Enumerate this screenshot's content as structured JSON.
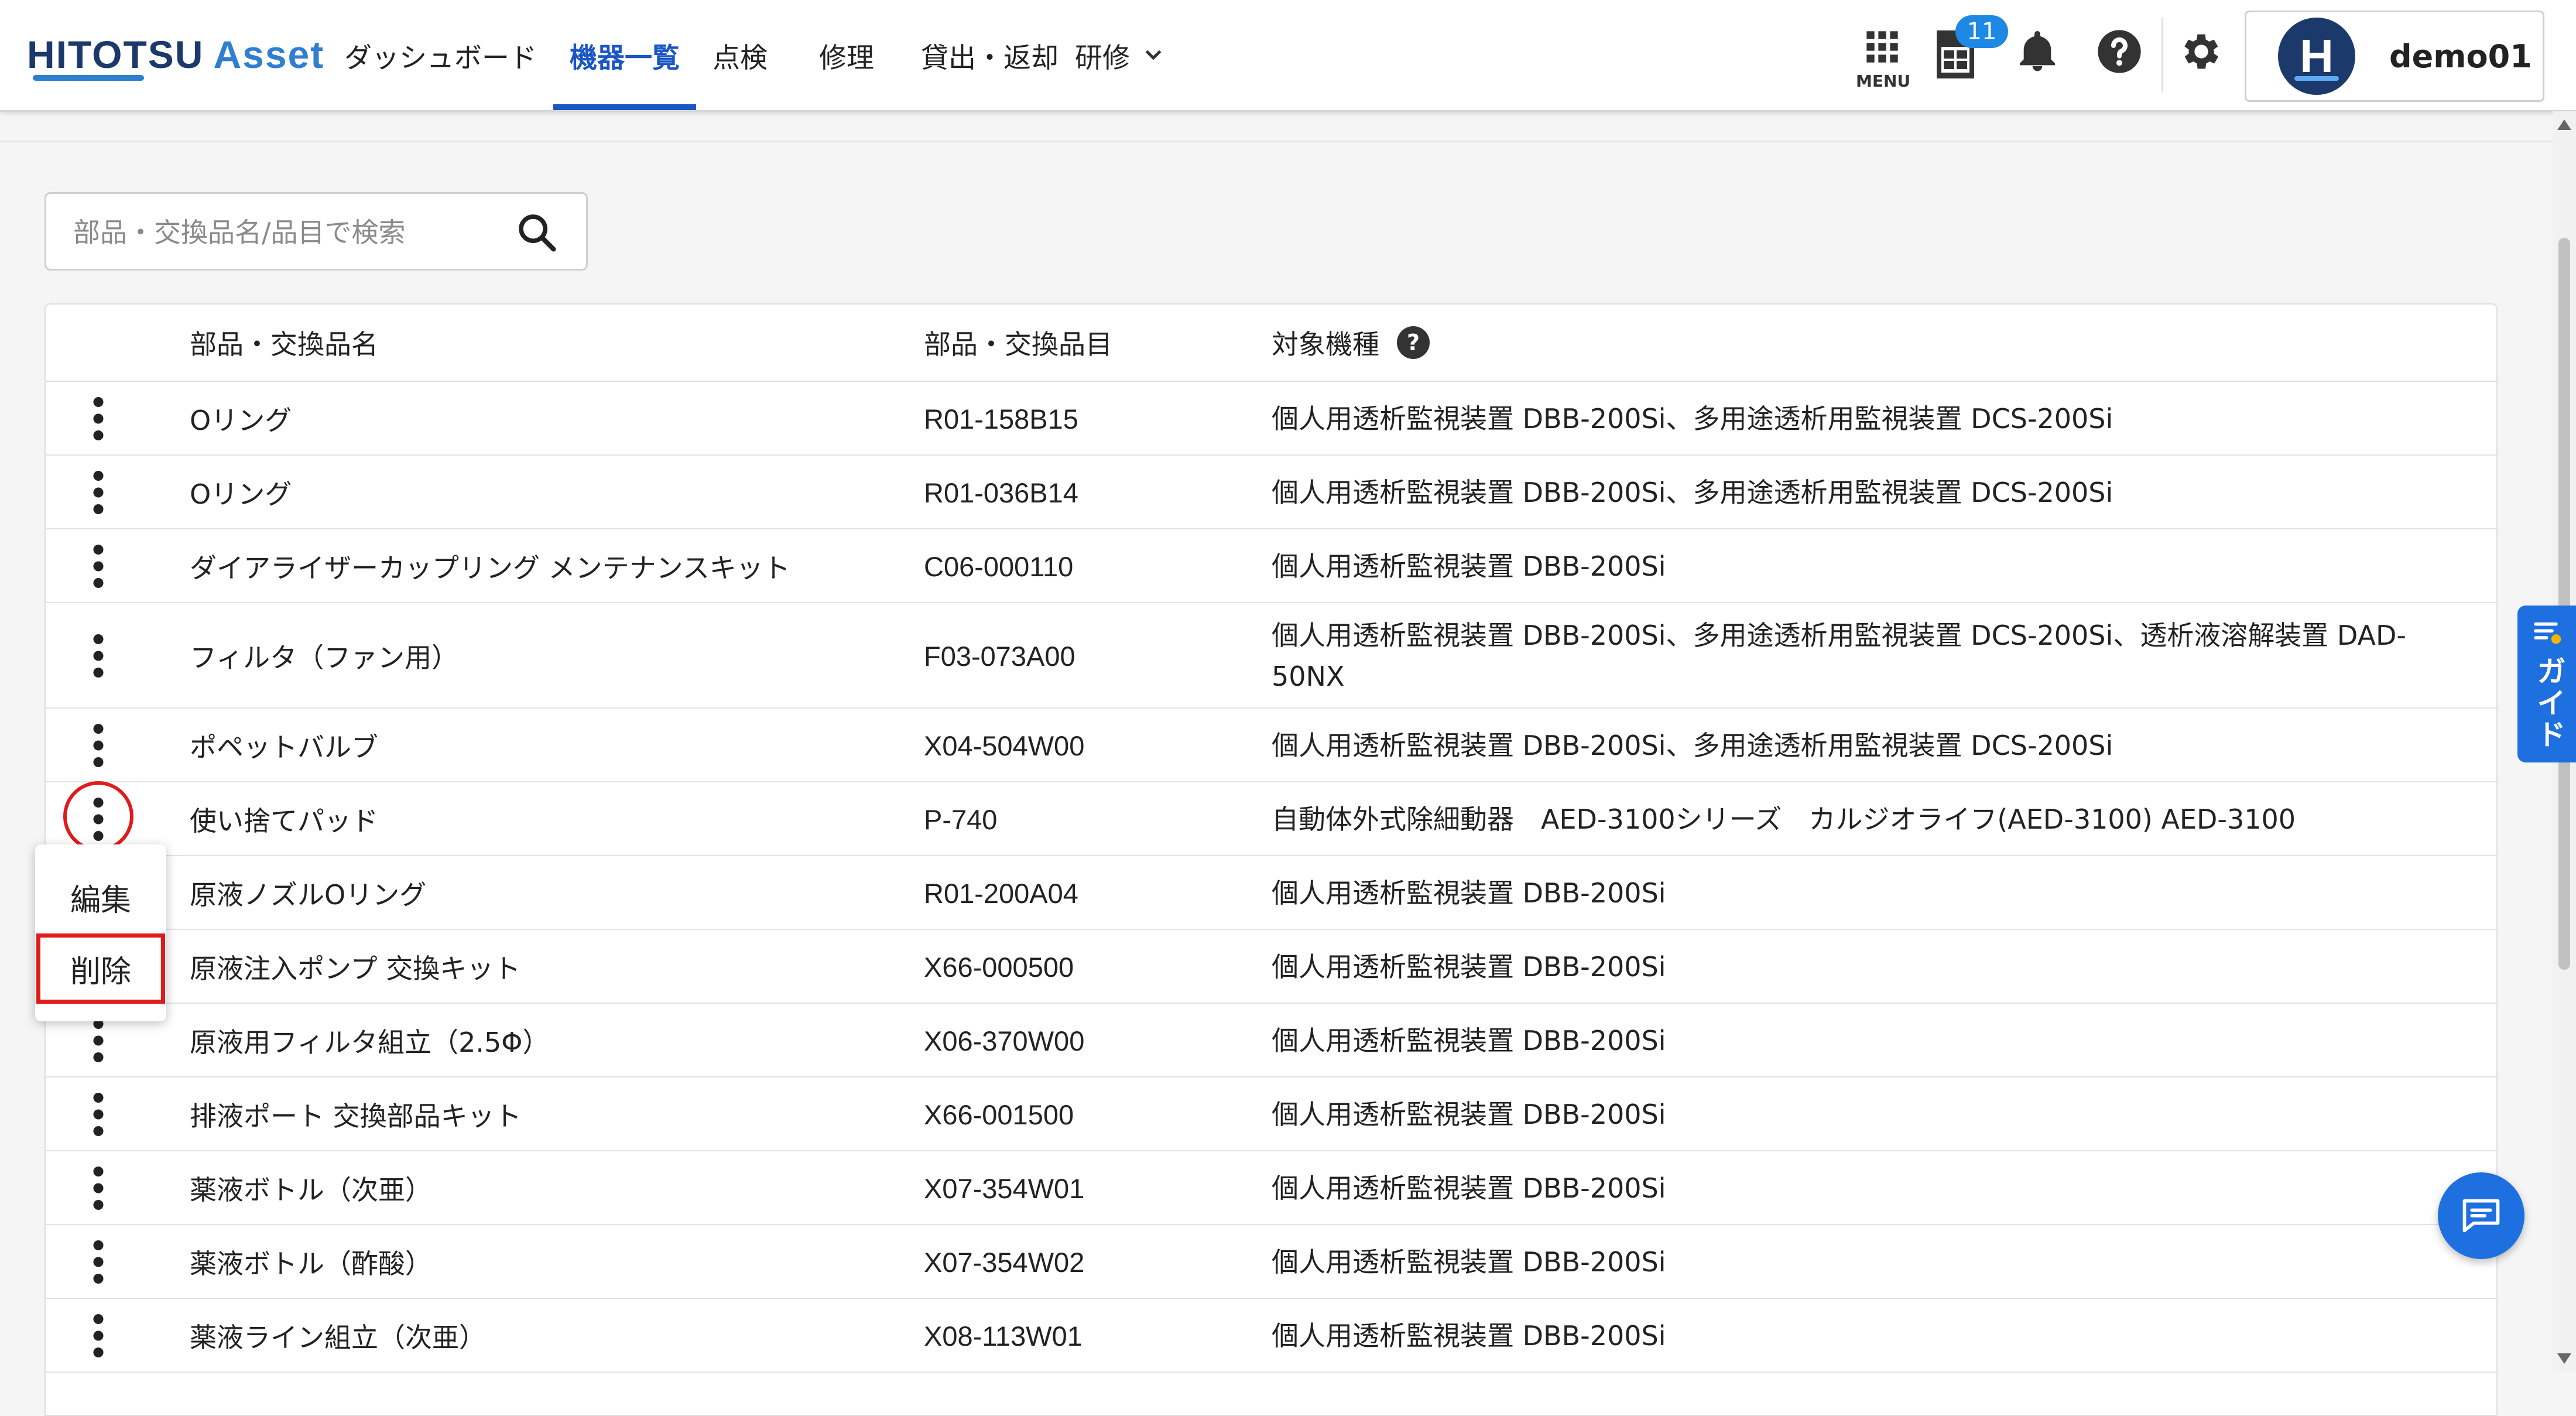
{
  "header": {
    "logo": {
      "primary": "HITOTSU",
      "secondary": "Asset"
    },
    "nav": [
      {
        "label": "ダッシュボード"
      },
      {
        "label": "機器一覧",
        "active": true
      },
      {
        "label": "点検"
      },
      {
        "label": "修理"
      },
      {
        "label": "貸出・返却"
      },
      {
        "label": "研修",
        "dropdown": true
      }
    ],
    "menu_label": "MENU",
    "pmda_badge": "11",
    "user": {
      "avatar_letter": "H",
      "name": "demo01"
    }
  },
  "search": {
    "placeholder": "部品・交換品名/品目で検索",
    "value": ""
  },
  "table": {
    "columns": [
      "部品・交換品名",
      "部品・交換品目",
      "対象機種"
    ],
    "help_glyph": "?",
    "rows": [
      {
        "name": "Oリング",
        "code": "R01-158B15",
        "target": "個人用透析監視装置 DBB-200Si、多用途透析用監視装置 DCS-200Si"
      },
      {
        "name": "Oリング",
        "code": "R01-036B14",
        "target": "個人用透析監視装置 DBB-200Si、多用途透析用監視装置 DCS-200Si"
      },
      {
        "name": "ダイアライザーカップリング メンテナンスキット",
        "code": "C06-000110",
        "target": "個人用透析監視装置 DBB-200Si"
      },
      {
        "name": "フィルタ（ファン用）",
        "code": "F03-073A00",
        "target": "個人用透析監視装置 DBB-200Si、多用途透析用監視装置 DCS-200Si、透析液溶解装置 DAD-50NX"
      },
      {
        "name": "ポペットバルブ",
        "code": "X04-504W00",
        "target": "個人用透析監視装置 DBB-200Si、多用途透析用監視装置 DCS-200Si"
      },
      {
        "name": "使い捨てパッド",
        "code": "P-740",
        "target": "自動体外式除細動器　AED-3100シリーズ　カルジオライフ(AED-3100) AED-3100"
      },
      {
        "name": "原液ノズルOリング",
        "code": "R01-200A04",
        "target": "個人用透析監視装置 DBB-200Si"
      },
      {
        "name": "原液注入ポンプ 交換キット",
        "code": "X66-000500",
        "target": "個人用透析監視装置 DBB-200Si"
      },
      {
        "name": "原液用フィルタ組立（2.5Φ）",
        "code": "X06-370W00",
        "target": "個人用透析監視装置 DBB-200Si"
      },
      {
        "name": "排液ポート 交換部品キット",
        "code": "X66-001500",
        "target": "個人用透析監視装置 DBB-200Si"
      },
      {
        "name": "薬液ボトル（次亜）",
        "code": "X07-354W01",
        "target": "個人用透析監視装置 DBB-200Si"
      },
      {
        "name": "薬液ボトル（酢酸）",
        "code": "X07-354W02",
        "target": "個人用透析監視装置 DBB-200Si"
      },
      {
        "name": "薬液ライン組立（次亜）",
        "code": "X08-113W01",
        "target": "個人用透析監視装置 DBB-200Si"
      }
    ]
  },
  "context_menu": {
    "items": [
      {
        "label": "編集"
      },
      {
        "label": "削除",
        "highlighted": true
      }
    ]
  },
  "guide_tab": {
    "label": "ガイド"
  },
  "colors": {
    "accent": "#1a56c4",
    "brand_dark": "#1b3a6b",
    "brand_light": "#2f7fd1",
    "highlight": "#e01b1b",
    "badge": "#1e88e5"
  }
}
